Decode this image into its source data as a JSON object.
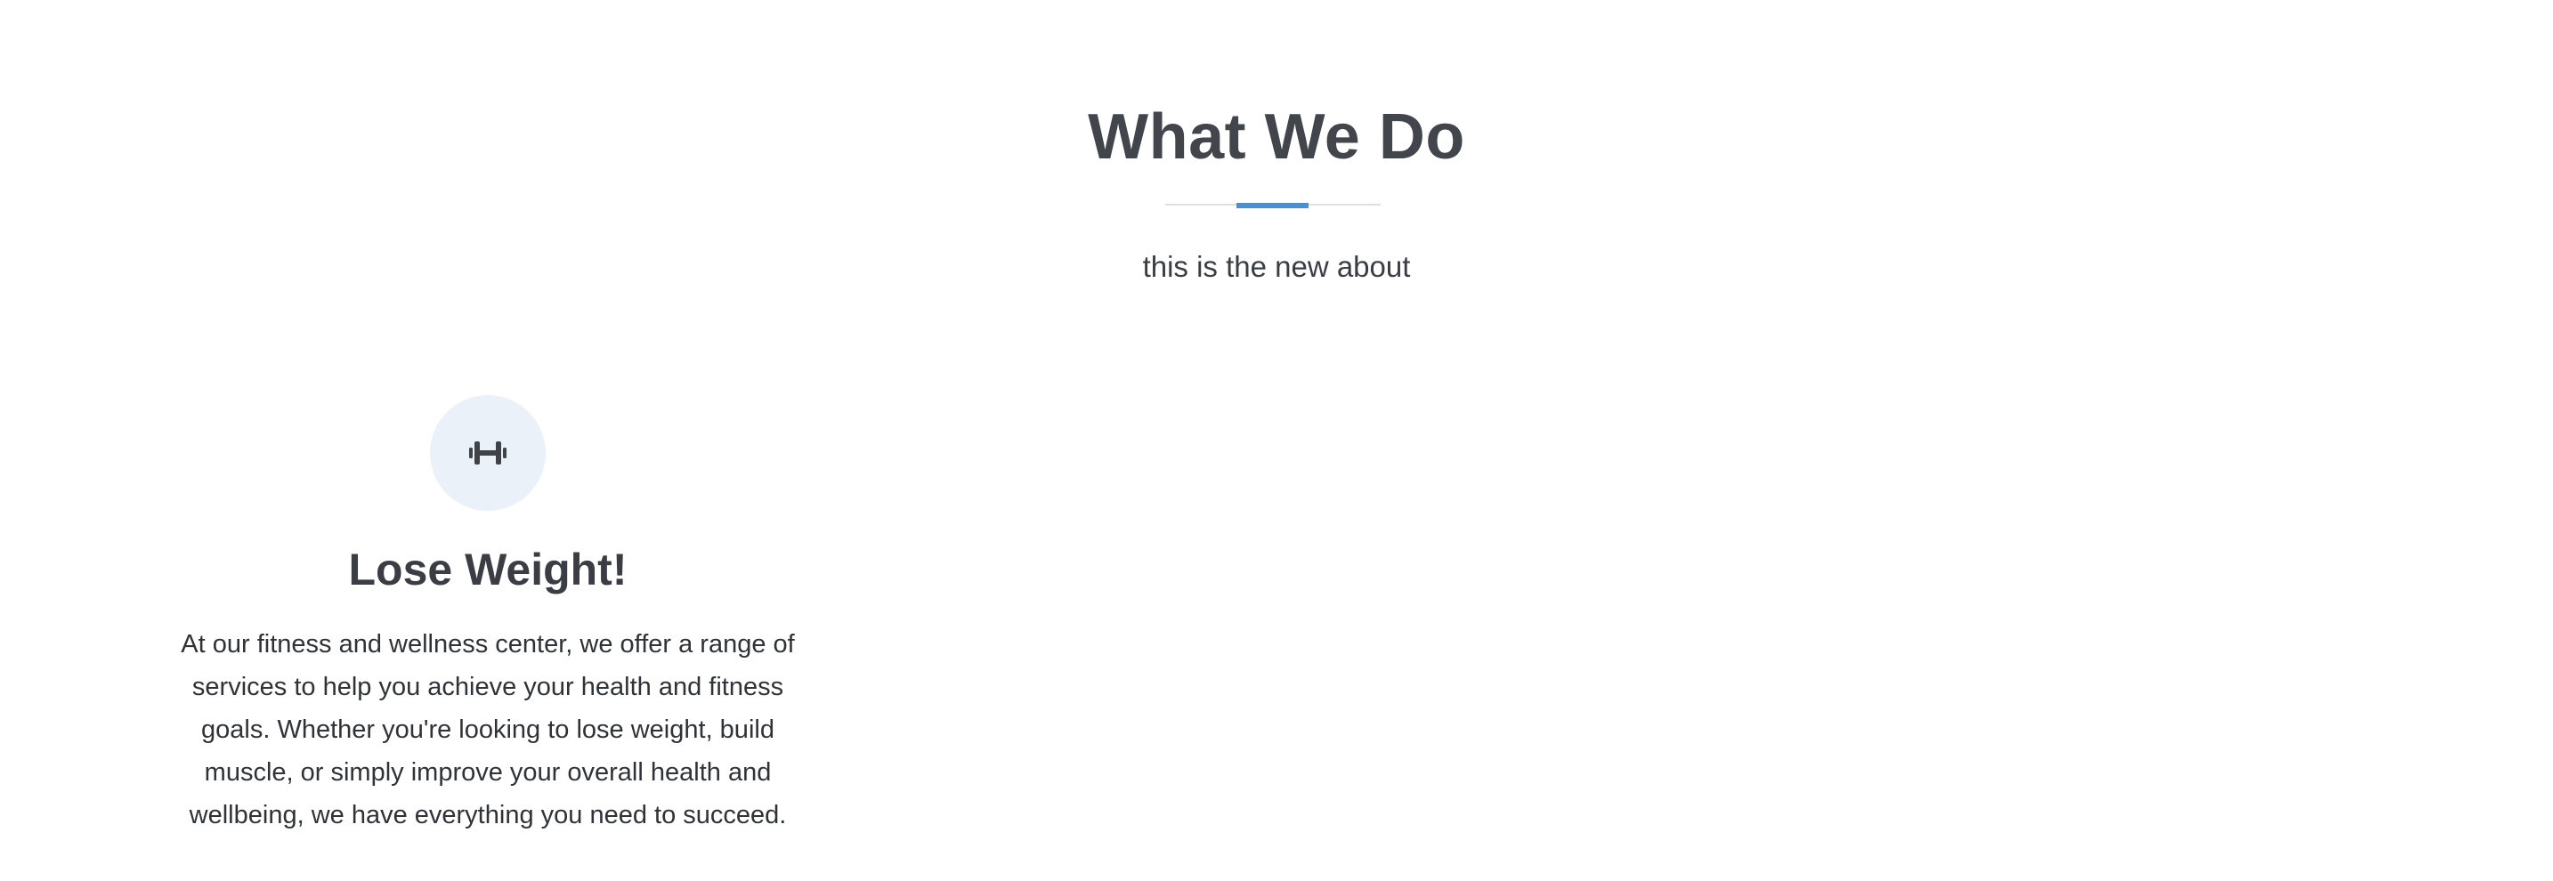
{
  "about": {
    "title": "What We Do",
    "subtitle": "this is the new about",
    "accent_color": "#4a8fd0"
  },
  "services": [
    {
      "icon": "dumbbell-icon",
      "title": "Lose Weight!",
      "description": "At our fitness and wellness center, we offer a range of services to help you achieve your health and fitness goals. Whether you're looking to lose weight, build muscle, or simply improve your overall health and wellbeing, we have everything you need to succeed."
    }
  ]
}
